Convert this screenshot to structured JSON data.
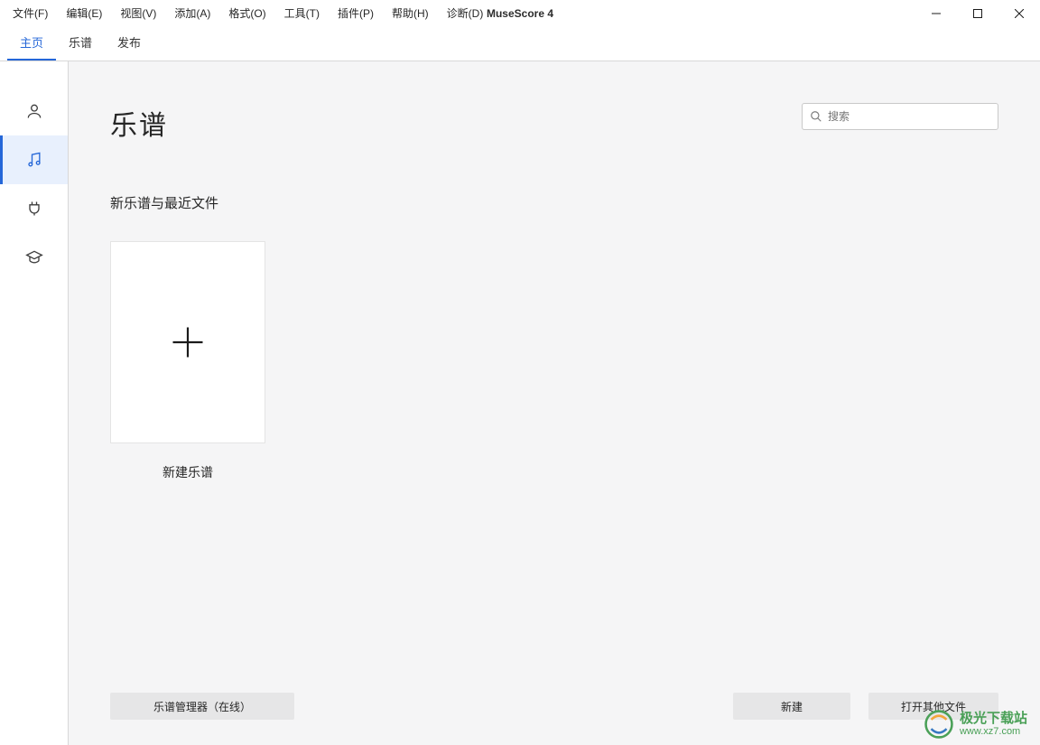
{
  "app_title": "MuseScore 4",
  "menubar": {
    "items": [
      "文件(F)",
      "编辑(E)",
      "视图(V)",
      "添加(A)",
      "格式(O)",
      "工具(T)",
      "插件(P)",
      "帮助(H)",
      "诊断(D)"
    ]
  },
  "tabs": [
    {
      "label": "主页",
      "active": true
    },
    {
      "label": "乐谱",
      "active": false
    },
    {
      "label": "发布",
      "active": false
    }
  ],
  "sidebar": {
    "items": [
      {
        "name": "account",
        "active": false
      },
      {
        "name": "scores",
        "active": true
      },
      {
        "name": "plugins",
        "active": false
      },
      {
        "name": "learn",
        "active": false
      }
    ]
  },
  "main": {
    "title": "乐谱",
    "search_placeholder": "搜索",
    "subtitle": "新乐谱与最近文件",
    "new_score_label": "新建乐谱"
  },
  "footer": {
    "left_button": "乐谱管理器（在线）",
    "new_button": "新建",
    "open_other_button": "打开其他文件"
  },
  "watermark": {
    "zh": "极光下载站",
    "en": "www.xz7.com"
  }
}
